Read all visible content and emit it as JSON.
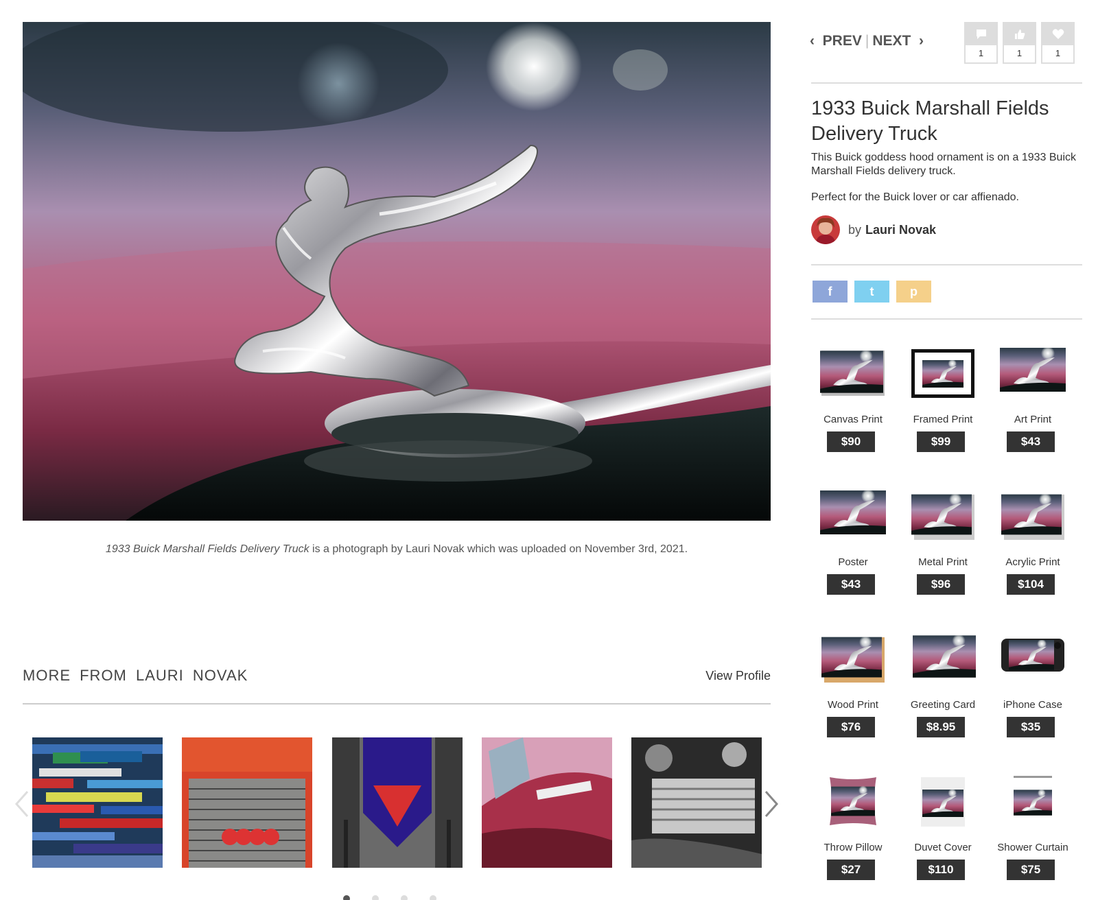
{
  "artwork": {
    "title": "1933 Buick Marshall Fields Delivery Truck",
    "description_1": "This Buick goddess hood ornament is on a 1933 Buick Marshall Fields delivery truck.",
    "description_2": "Perfect for the Buick lover or car affienado.",
    "by_label": "by",
    "artist": "Lauri Novak"
  },
  "caption": {
    "title": "1933 Buick Marshall Fields Delivery Truck",
    "rest": " is a photograph by Lauri Novak which was uploaded on November 3rd, 2021."
  },
  "nav": {
    "prev": "PREV",
    "separator": "|",
    "next": "NEXT"
  },
  "stats": {
    "comments": "1",
    "likes": "1",
    "favorites": "1"
  },
  "share": [
    {
      "name": "facebook",
      "glyph": "f",
      "color": "#8ea6d9"
    },
    {
      "name": "twitter",
      "glyph": "t",
      "color": "#7fd0f0"
    },
    {
      "name": "pinterest",
      "glyph": "p",
      "color": "#f5d08a"
    }
  ],
  "more": {
    "title": "MORE FROM LAURI NOVAK",
    "view_profile": "View Profile",
    "thumbs": [
      "badges-collage",
      "red-car-grille",
      "audi-emblem",
      "charger-fender",
      "engine-bw"
    ]
  },
  "products": [
    {
      "name": "Canvas Print",
      "price": "$90"
    },
    {
      "name": "Framed Print",
      "price": "$99"
    },
    {
      "name": "Art Print",
      "price": "$43"
    },
    {
      "name": "Poster",
      "price": "$43"
    },
    {
      "name": "Metal Print",
      "price": "$96"
    },
    {
      "name": "Acrylic Print",
      "price": "$104"
    },
    {
      "name": "Wood Print",
      "price": "$76"
    },
    {
      "name": "Greeting Card",
      "price": "$8.95"
    },
    {
      "name": "iPhone Case",
      "price": "$35"
    },
    {
      "name": "Throw Pillow",
      "price": "$27"
    },
    {
      "name": "Duvet Cover",
      "price": "$110"
    },
    {
      "name": "Shower Curtain",
      "price": "$75"
    }
  ],
  "colors": {
    "price_bg": "#333333",
    "divider": "#dddddd",
    "text": "#333333"
  }
}
